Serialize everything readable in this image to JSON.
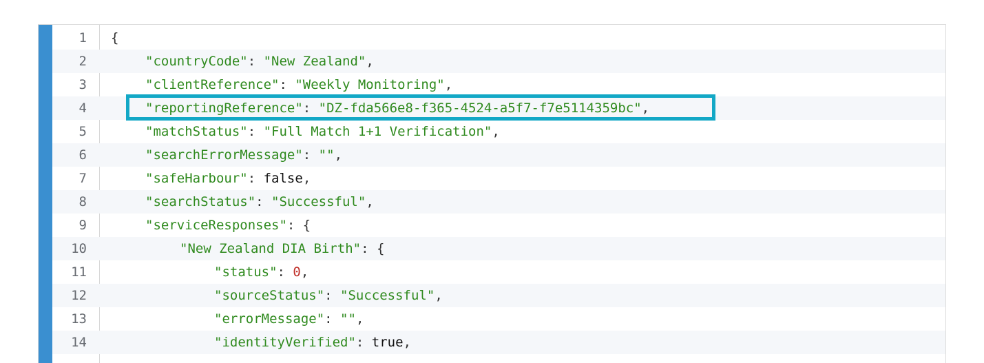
{
  "colors": {
    "accent_bar": "#3a8fd0",
    "highlight": "#13a8c6",
    "key": "#2f8a1e",
    "number": "#c0302a"
  },
  "lines": [
    {
      "num": "1",
      "indent": 0,
      "tokens": [
        {
          "t": "punc",
          "v": "{"
        }
      ]
    },
    {
      "num": "2",
      "indent": 1,
      "tokens": [
        {
          "t": "key",
          "v": "\"countryCode\""
        },
        {
          "t": "punc",
          "v": ": "
        },
        {
          "t": "str",
          "v": "\"New Zealand\""
        },
        {
          "t": "punc",
          "v": ","
        }
      ]
    },
    {
      "num": "3",
      "indent": 1,
      "tokens": [
        {
          "t": "key",
          "v": "\"clientReference\""
        },
        {
          "t": "punc",
          "v": ": "
        },
        {
          "t": "str",
          "v": "\"Weekly Monitoring\""
        },
        {
          "t": "punc",
          "v": ","
        }
      ]
    },
    {
      "num": "4",
      "indent": 1,
      "tokens": [
        {
          "t": "key",
          "v": "\"reportingReference\""
        },
        {
          "t": "punc",
          "v": ": "
        },
        {
          "t": "str",
          "v": "\"DZ-fda566e8-f365-4524-a5f7-f7e5114359bc\""
        },
        {
          "t": "punc",
          "v": ","
        }
      ]
    },
    {
      "num": "5",
      "indent": 1,
      "tokens": [
        {
          "t": "key",
          "v": "\"matchStatus\""
        },
        {
          "t": "punc",
          "v": ": "
        },
        {
          "t": "str",
          "v": "\"Full Match 1+1 Verification\""
        },
        {
          "t": "punc",
          "v": ","
        }
      ]
    },
    {
      "num": "6",
      "indent": 1,
      "tokens": [
        {
          "t": "key",
          "v": "\"searchErrorMessage\""
        },
        {
          "t": "punc",
          "v": ": "
        },
        {
          "t": "str",
          "v": "\"\""
        },
        {
          "t": "punc",
          "v": ","
        }
      ]
    },
    {
      "num": "7",
      "indent": 1,
      "tokens": [
        {
          "t": "key",
          "v": "\"safeHarbour\""
        },
        {
          "t": "punc",
          "v": ": "
        },
        {
          "t": "bool",
          "v": "false"
        },
        {
          "t": "punc",
          "v": ","
        }
      ]
    },
    {
      "num": "8",
      "indent": 1,
      "tokens": [
        {
          "t": "key",
          "v": "\"searchStatus\""
        },
        {
          "t": "punc",
          "v": ": "
        },
        {
          "t": "str",
          "v": "\"Successful\""
        },
        {
          "t": "punc",
          "v": ","
        }
      ]
    },
    {
      "num": "9",
      "indent": 1,
      "tokens": [
        {
          "t": "key",
          "v": "\"serviceResponses\""
        },
        {
          "t": "punc",
          "v": ": {"
        }
      ]
    },
    {
      "num": "10",
      "indent": 2,
      "tokens": [
        {
          "t": "key",
          "v": "\"New Zealand DIA Birth\""
        },
        {
          "t": "punc",
          "v": ": {"
        }
      ]
    },
    {
      "num": "11",
      "indent": 3,
      "tokens": [
        {
          "t": "key",
          "v": "\"status\""
        },
        {
          "t": "punc",
          "v": ": "
        },
        {
          "t": "num",
          "v": "0"
        },
        {
          "t": "punc",
          "v": ","
        }
      ]
    },
    {
      "num": "12",
      "indent": 3,
      "tokens": [
        {
          "t": "key",
          "v": "\"sourceStatus\""
        },
        {
          "t": "punc",
          "v": ": "
        },
        {
          "t": "str",
          "v": "\"Successful\""
        },
        {
          "t": "punc",
          "v": ","
        }
      ]
    },
    {
      "num": "13",
      "indent": 3,
      "tokens": [
        {
          "t": "key",
          "v": "\"errorMessage\""
        },
        {
          "t": "punc",
          "v": ": "
        },
        {
          "t": "str",
          "v": "\"\""
        },
        {
          "t": "punc",
          "v": ","
        }
      ]
    },
    {
      "num": "14",
      "indent": 3,
      "tokens": [
        {
          "t": "key",
          "v": "\"identityVerified\""
        },
        {
          "t": "punc",
          "v": ": "
        },
        {
          "t": "bool",
          "v": "true"
        },
        {
          "t": "punc",
          "v": ","
        }
      ]
    }
  ]
}
